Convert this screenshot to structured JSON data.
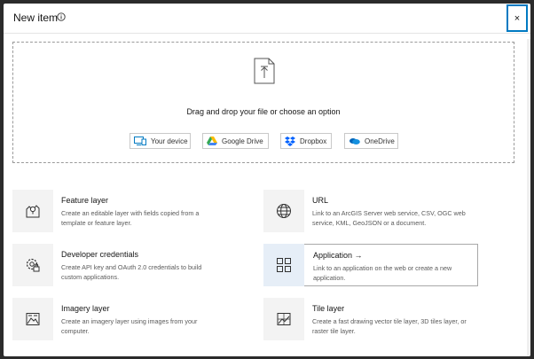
{
  "header": {
    "title": "New item",
    "info_icon": "info-icon",
    "close_label": "×"
  },
  "dropzone": {
    "icon": "upload-icon",
    "text": "Drag and drop your file or choose an option",
    "options": [
      {
        "label": "Your device",
        "icon": "device-icon"
      },
      {
        "label": "Google Drive",
        "icon": "google-drive-icon"
      },
      {
        "label": "Dropbox",
        "icon": "dropbox-icon"
      },
      {
        "label": "OneDrive",
        "icon": "onedrive-icon"
      }
    ]
  },
  "cards": [
    {
      "title": "Feature layer",
      "description": "Create an editable layer with fields copied from a template or feature layer.",
      "icon": "feature-layer-icon"
    },
    {
      "title": "URL",
      "description": "Link to an ArcGIS Server web service, CSV, OGC web service, KML, GeoJSON or a document.",
      "icon": "globe-icon"
    },
    {
      "title": "Developer credentials",
      "description": "Create API key and OAuth 2.0 credentials to build custom applications.",
      "icon": "developer-credentials-icon"
    },
    {
      "title": "Application →",
      "description": "Link to an application on the web or create a new application.",
      "icon": "grid-apps-icon"
    },
    {
      "title": "Imagery layer",
      "description": "Create an imagery layer using images from your computer.",
      "icon": "imagery-layer-icon"
    },
    {
      "title": "Tile layer",
      "description": "Create a fast drawing vector tile layer, 3D tiles layer, or raster tile layer.",
      "icon": "tile-layer-icon"
    }
  ],
  "colors": {
    "accent": "#007ac2",
    "selected_tile": "#e6eef7"
  }
}
